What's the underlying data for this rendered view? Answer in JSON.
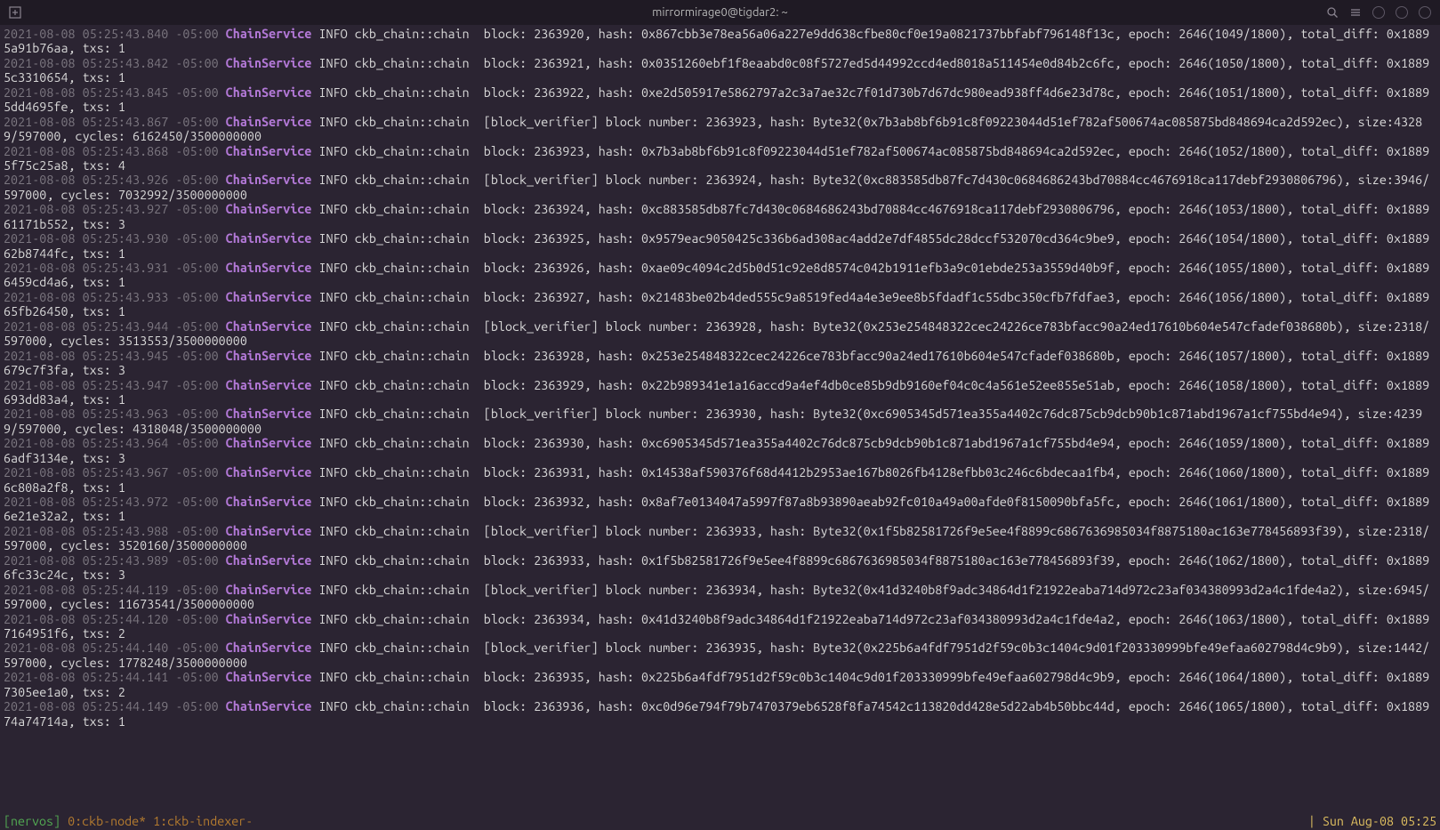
{
  "titlebar": {
    "title": "mirrormirage0@tigdar2: ~"
  },
  "log": {
    "tz": "-05:00",
    "service": "ChainService",
    "level": "INFO",
    "module": "ckb_chain::chain",
    "verifier_tag": "[block_verifier]",
    "entries": [
      {
        "ts": "2021-08-08 05:25:43.840",
        "type": "block",
        "block": "2363920",
        "hash": "0x867cbb3e78ea56a06a227e9dd638cfbe80cf0e19a0821737bbfabf796148f13c",
        "epoch": "2646(1049/1800)",
        "diff": "0x18895a91b76aa",
        "txs": "1"
      },
      {
        "ts": "2021-08-08 05:25:43.842",
        "type": "block",
        "block": "2363921",
        "hash": "0x0351260ebf1f8eaabd0c08f5727ed5d44992ccd4ed8018a511454e0d84b2c6fc",
        "epoch": "2646(1050/1800)",
        "diff": "0x18895c3310654",
        "txs": "1"
      },
      {
        "ts": "2021-08-08 05:25:43.845",
        "type": "block",
        "block": "2363922",
        "hash": "0xe2d505917e5862797a2c3a7ae32c7f01d730b7d67dc980ead938ff4d6e23d78c",
        "epoch": "2646(1051/1800)",
        "diff": "0x18895dd4695fe",
        "txs": "1"
      },
      {
        "ts": "2021-08-08 05:25:43.867",
        "type": "verifier",
        "block": "2363923",
        "hash": "Byte32(0x7b3ab8bf6b91c8f09223044d51ef782af500674ac085875bd848694ca2d592ec)",
        "size": "43289/597000",
        "cycles": "6162450/3500000000"
      },
      {
        "ts": "2021-08-08 05:25:43.868",
        "type": "block",
        "block": "2363923",
        "hash": "0x7b3ab8bf6b91c8f09223044d51ef782af500674ac085875bd848694ca2d592ec",
        "epoch": "2646(1052/1800)",
        "diff": "0x18895f75c25a8",
        "txs": "4"
      },
      {
        "ts": "2021-08-08 05:25:43.926",
        "type": "verifier",
        "block": "2363924",
        "hash": "Byte32(0xc883585db87fc7d430c0684686243bd70884cc4676918ca117debf2930806796)",
        "size": "3946/597000",
        "cycles": "7032992/3500000000"
      },
      {
        "ts": "2021-08-08 05:25:43.927",
        "type": "block",
        "block": "2363924",
        "hash": "0xc883585db87fc7d430c0684686243bd70884cc4676918ca117debf2930806796",
        "epoch": "2646(1053/1800)",
        "diff": "0x188961171b552",
        "txs": "3"
      },
      {
        "ts": "2021-08-08 05:25:43.930",
        "type": "block",
        "block": "2363925",
        "hash": "0x9579eac9050425c336b6ad308ac4add2e7df4855dc28dccf532070cd364c9be9",
        "epoch": "2646(1054/1800)",
        "diff": "0x188962b8744fc",
        "txs": "1"
      },
      {
        "ts": "2021-08-08 05:25:43.931",
        "type": "block",
        "block": "2363926",
        "hash": "0xae09c4094c2d5b0d51c92e8d8574c042b1911efb3a9c01ebde253a3559d40b9f",
        "epoch": "2646(1055/1800)",
        "diff": "0x18896459cd4a6",
        "txs": "1"
      },
      {
        "ts": "2021-08-08 05:25:43.933",
        "type": "block",
        "block": "2363927",
        "hash": "0x21483be02b4ded555c9a8519fed4a4e3e9ee8b5fdadf1c55dbc350cfb7fdfae3",
        "epoch": "2646(1056/1800)",
        "diff": "0x188965fb26450",
        "txs": "1"
      },
      {
        "ts": "2021-08-08 05:25:43.944",
        "type": "verifier",
        "block": "2363928",
        "hash": "Byte32(0x253e254848322cec24226ce783bfacc90a24ed17610b604e547cfadef038680b)",
        "size": "2318/597000",
        "cycles": "3513553/3500000000"
      },
      {
        "ts": "2021-08-08 05:25:43.945",
        "type": "block",
        "block": "2363928",
        "hash": "0x253e254848322cec24226ce783bfacc90a24ed17610b604e547cfadef038680b",
        "epoch": "2646(1057/1800)",
        "diff": "0x1889679c7f3fa",
        "txs": "3"
      },
      {
        "ts": "2021-08-08 05:25:43.947",
        "type": "block",
        "block": "2363929",
        "hash": "0x22b989341e1a16accd9a4ef4db0ce85b9db9160ef04c0c4a561e52ee855e51ab",
        "epoch": "2646(1058/1800)",
        "diff": "0x1889693dd83a4",
        "txs": "1"
      },
      {
        "ts": "2021-08-08 05:25:43.963",
        "type": "verifier",
        "block": "2363930",
        "hash": "Byte32(0xc6905345d571ea355a4402c76dc875cb9dcb90b1c871abd1967a1cf755bd4e94)",
        "size": "42399/597000",
        "cycles": "4318048/3500000000"
      },
      {
        "ts": "2021-08-08 05:25:43.964",
        "type": "block",
        "block": "2363930",
        "hash": "0xc6905345d571ea355a4402c76dc875cb9dcb90b1c871abd1967a1cf755bd4e94",
        "epoch": "2646(1059/1800)",
        "diff": "0x18896adf3134e",
        "txs": "3"
      },
      {
        "ts": "2021-08-08 05:25:43.967",
        "type": "block",
        "block": "2363931",
        "hash": "0x14538af590376f68d4412b2953ae167b8026fb4128efbb03c246c6bdecaa1fb4",
        "epoch": "2646(1060/1800)",
        "diff": "0x18896c808a2f8",
        "txs": "1"
      },
      {
        "ts": "2021-08-08 05:25:43.972",
        "type": "block",
        "block": "2363932",
        "hash": "0x8af7e0134047a5997f87a8b93890aeab92fc010a49a00afde0f8150090bfa5fc",
        "epoch": "2646(1061/1800)",
        "diff": "0x18896e21e32a2",
        "txs": "1"
      },
      {
        "ts": "2021-08-08 05:25:43.988",
        "type": "verifier",
        "block": "2363933",
        "hash": "Byte32(0x1f5b82581726f9e5ee4f8899c6867636985034f8875180ac163e778456893f39)",
        "size": "2318/597000",
        "cycles": "3520160/3500000000"
      },
      {
        "ts": "2021-08-08 05:25:43.989",
        "type": "block",
        "block": "2363933",
        "hash": "0x1f5b82581726f9e5ee4f8899c6867636985034f8875180ac163e778456893f39",
        "epoch": "2646(1062/1800)",
        "diff": "0x18896fc33c24c",
        "txs": "3"
      },
      {
        "ts": "2021-08-08 05:25:44.119",
        "type": "verifier",
        "block": "2363934",
        "hash": "Byte32(0x41d3240b8f9adc34864d1f21922eaba714d972c23af034380993d2a4c1fde4a2)",
        "size": "6945/597000",
        "cycles": "11673541/3500000000"
      },
      {
        "ts": "2021-08-08 05:25:44.120",
        "type": "block",
        "block": "2363934",
        "hash": "0x41d3240b8f9adc34864d1f21922eaba714d972c23af034380993d2a4c1fde4a2",
        "epoch": "2646(1063/1800)",
        "diff": "0x18897164951f6",
        "txs": "2"
      },
      {
        "ts": "2021-08-08 05:25:44.140",
        "type": "verifier",
        "block": "2363935",
        "hash": "Byte32(0x225b6a4fdf7951d2f59c0b3c1404c9d01f203330999bfe49efaa602798d4c9b9)",
        "size": "1442/597000",
        "cycles": "1778248/3500000000"
      },
      {
        "ts": "2021-08-08 05:25:44.141",
        "type": "block",
        "block": "2363935",
        "hash": "0x225b6a4fdf7951d2f59c0b3c1404c9d01f203330999bfe49efaa602798d4c9b9",
        "epoch": "2646(1064/1800)",
        "diff": "0x18897305ee1a0",
        "txs": "2"
      },
      {
        "ts": "2021-08-08 05:25:44.149",
        "type": "block",
        "block": "2363936",
        "hash": "0xc0d96e794f79b7470379eb6528f8fa74542c113820dd428e5d22ab4b50bbc44d",
        "epoch": "2646(1065/1800)",
        "diff": "0x188974a74714a",
        "txs": "1"
      }
    ]
  },
  "statusbar": {
    "session": "[nervos]",
    "windows": " 0:ckb-node* 1:ckb-indexer-",
    "clock": "Sun Aug-08 05:25"
  }
}
